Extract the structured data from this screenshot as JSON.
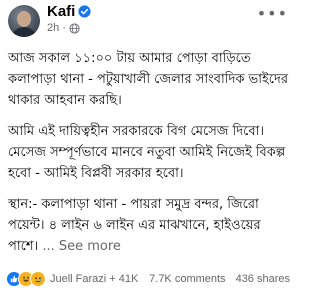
{
  "header": {
    "author": "Kafi",
    "time": "2h",
    "separator": "·",
    "more": "•••"
  },
  "post": {
    "para1": "আজ সকাল ১১:০০ টায় আমার পোড়া বাড়িতে কলাপাড়া থানা - পটুয়াখালী জেলার সাংবাদিক ভাইদের থাকার আহবান করছি।",
    "para2": "আমি এই দায়িত্বহীন সরকারকে বিগ মেসেজ দিবো। মেসেজ সম্পূর্ণভাবে মানবে নতুবা আমিই নিজেই বিকল্প হবো - আমিই বিপ্লবী সরকার হবো।",
    "para3": "স্থান:- কলাপাড়া থানা - পায়রা সমুদ্র বন্দর, জিরো পয়েন্ট। ৪ লাইন ৬ লাইন এর মাঝখানে, হাইওয়ের পাশে।",
    "see_more": "... See more"
  },
  "footer": {
    "reactors": "Juell Farazi + 41K",
    "comments": "7.7K comments",
    "shares": "436 shares"
  },
  "colors": {
    "verified": "#1877f2",
    "secondary_text": "#65676b"
  }
}
